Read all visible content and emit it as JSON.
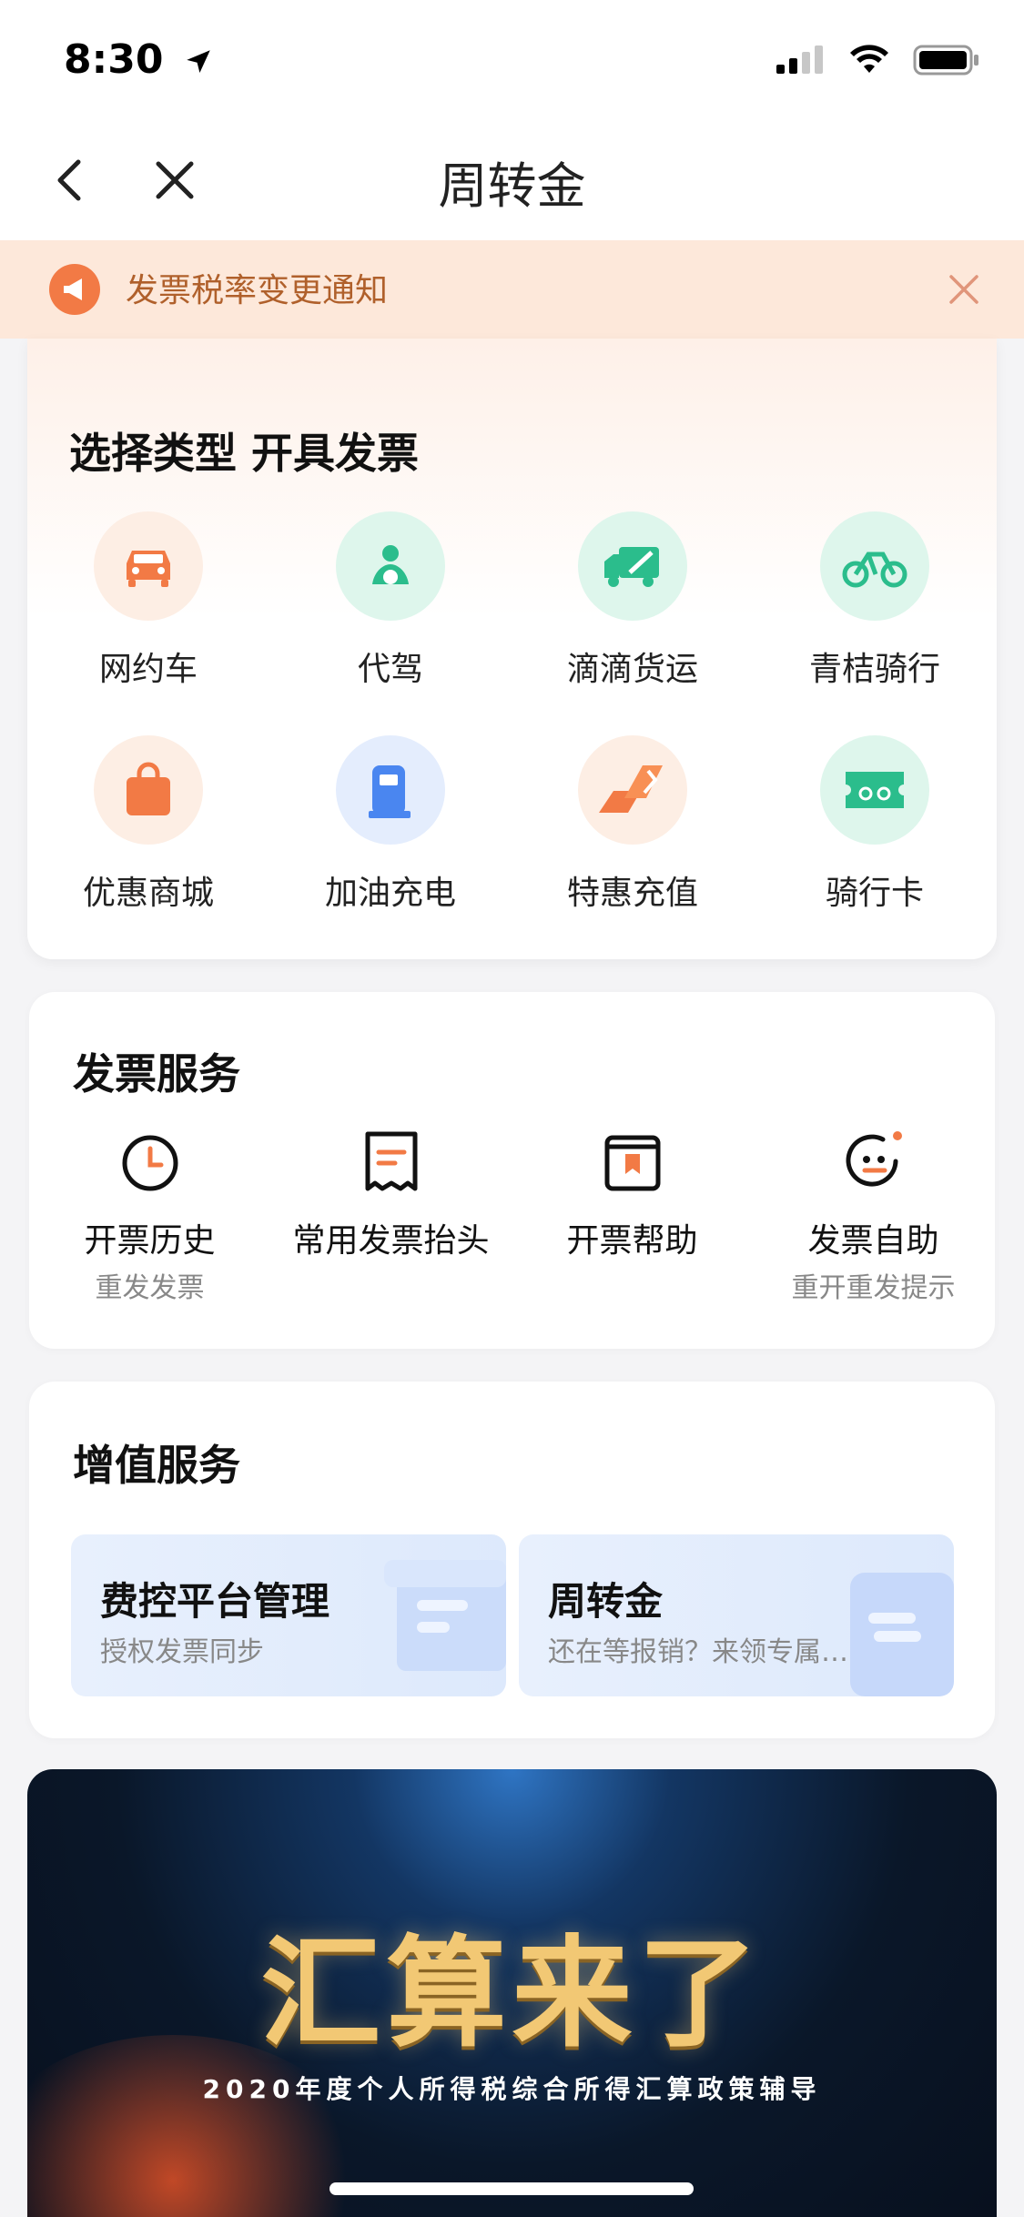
{
  "status_bar": {
    "time": "8:30"
  },
  "nav": {
    "title": "周转金"
  },
  "notice": {
    "text": "发票税率变更通知"
  },
  "invoice_types": {
    "title": "选择类型 开具发票",
    "items": [
      {
        "label": "网约车",
        "icon": "car-icon"
      },
      {
        "label": "代驾",
        "icon": "driver-icon"
      },
      {
        "label": "滴滴货运",
        "icon": "truck-icon"
      },
      {
        "label": "青桔骑行",
        "icon": "bike-icon"
      },
      {
        "label": "优惠商城",
        "icon": "shopping-bag-icon"
      },
      {
        "label": "加油充电",
        "icon": "fuel-pump-icon"
      },
      {
        "label": "特惠充值",
        "icon": "recharge-icon"
      },
      {
        "label": "骑行卡",
        "icon": "ticket-card-icon"
      }
    ]
  },
  "invoice_service": {
    "title": "发票服务",
    "items": [
      {
        "label": "开票历史",
        "sub": "重发发票",
        "icon": "clock-icon"
      },
      {
        "label": "常用发票抬头",
        "sub": "",
        "icon": "receipt-icon"
      },
      {
        "label": "开票帮助",
        "sub": "",
        "icon": "help-book-icon"
      },
      {
        "label": "发票自助",
        "sub": "重开重发提示",
        "icon": "robot-assistant-icon"
      }
    ]
  },
  "value_service": {
    "title": "增值服务",
    "items": [
      {
        "title": "费控平台管理",
        "sub": "授权发票同步"
      },
      {
        "title": "周转金",
        "sub": "还在等报销？来领专属…"
      }
    ]
  },
  "banner": {
    "title": "汇算来了",
    "subtitle": "2020年度个人所得税综合所得汇算政策辅导"
  },
  "colors": {
    "accent_orange": "#f27a45",
    "accent_green": "#2bbd8c",
    "accent_blue": "#4a86f0",
    "notice_bg": "#fde8da"
  }
}
